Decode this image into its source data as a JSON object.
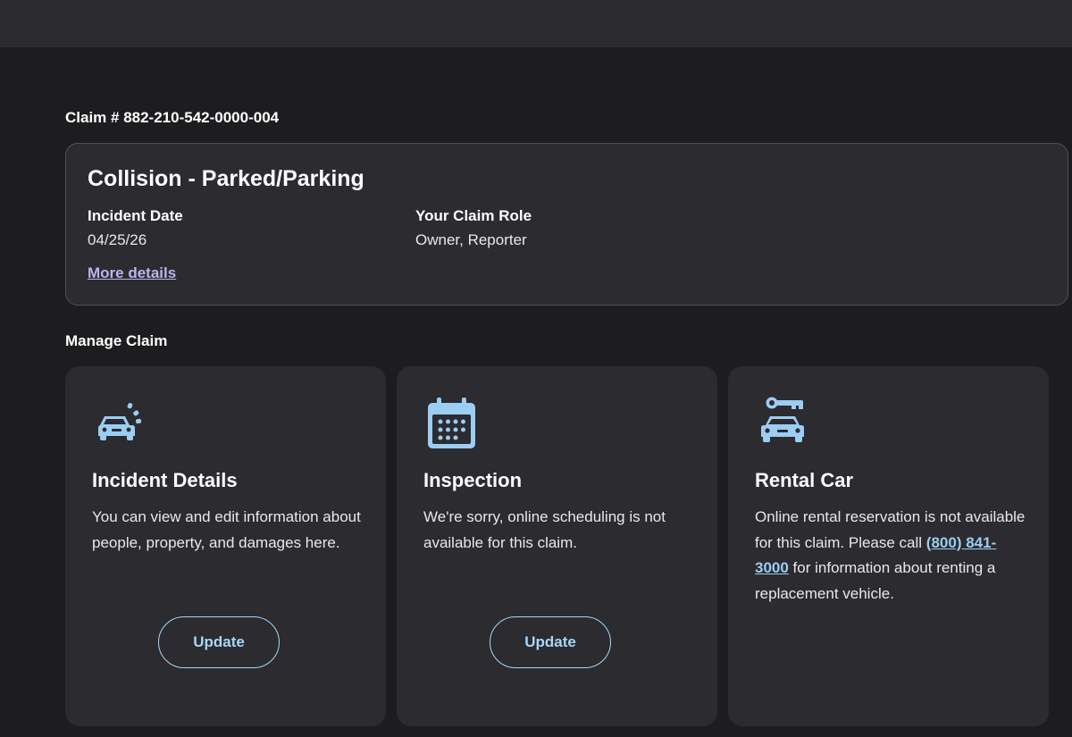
{
  "claim": {
    "number_label": "Claim # 882-210-542-0000-004",
    "type": "Collision - Parked/Parking",
    "incident_date_label": "Incident Date",
    "incident_date": "04/25/26",
    "role_label": "Your Claim Role",
    "role": "Owner, Reporter",
    "more_details": "More details"
  },
  "manage": {
    "title": "Manage Claim",
    "cards": [
      {
        "icon": "car-collision-icon",
        "title": "Incident Details",
        "description": "You can view and edit information about people, property, and damages here.",
        "button": "Update"
      },
      {
        "icon": "calendar-icon",
        "title": "Inspection",
        "description": "We're sorry, online scheduling is not available for this claim.",
        "button": "Update"
      },
      {
        "icon": "car-key-icon",
        "title": "Rental Car",
        "description_before": "Online rental reservation is not available for this claim. Please call ",
        "phone": "(800) 841-3000",
        "description_after": " for information about renting a replacement vehicle."
      }
    ]
  },
  "colors": {
    "accent_link": "#9ccdf2",
    "more_details_link": "#b9b6ee",
    "icon": "#9ccdf2",
    "card_bg": "#2b2b30",
    "page_bg": "#1d1d20"
  }
}
